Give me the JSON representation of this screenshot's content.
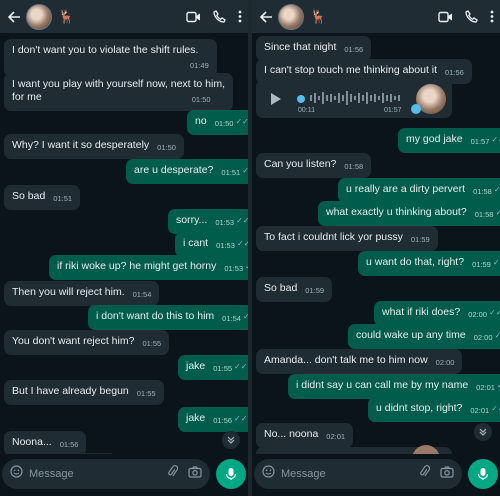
{
  "left": {
    "header": {
      "emoji": "🦌"
    },
    "messages": [
      {
        "dir": "in",
        "text": "I don't want you to violate the shift rules.",
        "time": "01:49"
      },
      {
        "dir": "in",
        "text": "I want you play with yourself now, next to him,",
        "text2": "for me",
        "time": "01:50"
      },
      {
        "dir": "out",
        "text": "no",
        "time": "01:50"
      },
      {
        "dir": "in",
        "text": "Why? I want it so desperately",
        "time": "01:50"
      },
      {
        "dir": "out",
        "text": "are u desperate?",
        "time": "01:51"
      },
      {
        "dir": "in",
        "text": "So bad",
        "time": "01:51"
      },
      {
        "dir": "out",
        "text": "sorry...",
        "time": "01:53"
      },
      {
        "dir": "out",
        "text": "i cant",
        "time": "01:53"
      },
      {
        "dir": "out",
        "text": "if riki woke up? he might get horny",
        "time": "01:53"
      },
      {
        "dir": "in",
        "text": "Then you will reject him.",
        "time": "01:54"
      },
      {
        "dir": "out",
        "text": "i don't want do this to him",
        "time": "01:54"
      },
      {
        "dir": "in",
        "text": "You don't want reject him?",
        "time": "01:55"
      },
      {
        "dir": "out",
        "text": "jake",
        "time": "01:55"
      },
      {
        "dir": "in",
        "text": "But I have already begun",
        "time": "01:55"
      },
      {
        "dir": "out",
        "text": "jake",
        "time": "01:56"
      },
      {
        "dir": "in",
        "text": "Noona...",
        "time": "01:56"
      }
    ],
    "input": {
      "placeholder": "Message"
    }
  },
  "right": {
    "header": {
      "emoji": "🦌"
    },
    "voice": {
      "duration": "00:11",
      "time": "01:57"
    },
    "messages": [
      {
        "dir": "in",
        "text": "Since that night",
        "time": "01:56"
      },
      {
        "dir": "in",
        "text": "I can't stop touch me thinking about it",
        "time": "01:56"
      },
      {
        "dir": "out",
        "text": "my god jake",
        "time": "01:57"
      },
      {
        "dir": "in",
        "text": "Can you listen?",
        "time": "01:58"
      },
      {
        "dir": "out",
        "text": "u really are a dirty pervert",
        "time": "01:58"
      },
      {
        "dir": "out",
        "text": "what exactly u thinking about?",
        "time": "01:58"
      },
      {
        "dir": "in",
        "text": "To fact i couldnt lick yor pussy",
        "time": "01:59"
      },
      {
        "dir": "out",
        "text": "u want do that, right?",
        "time": "01:59"
      },
      {
        "dir": "in",
        "text": "So bad",
        "time": "01:59"
      },
      {
        "dir": "out",
        "text": "what if riki does?",
        "time": "02:00"
      },
      {
        "dir": "out",
        "text": "could wake up any time",
        "time": "02:00"
      },
      {
        "dir": "in",
        "text": "Amanda... don't talk me to him now",
        "time": "02:00"
      },
      {
        "dir": "out",
        "text": "i didnt say u can call me by my name",
        "time": "02:01"
      },
      {
        "dir": "out",
        "text": "u didnt stop, right?",
        "time": "02:01"
      },
      {
        "dir": "in",
        "text": "No... noona",
        "time": "02:01"
      }
    ],
    "input": {
      "placeholder": "Message"
    }
  },
  "colors": {
    "bg": "#0b141a",
    "incoming": "#1f2c34",
    "outgoing": "#005c4b",
    "accent": "#00a884",
    "read_ticks": "#53bdeb"
  },
  "icons": [
    "back-arrow-icon",
    "video-call-icon",
    "phone-icon",
    "more-vert-icon",
    "emoji-icon",
    "attach-icon",
    "camera-icon",
    "mic-icon",
    "chevron-double-down-icon",
    "play-icon"
  ]
}
